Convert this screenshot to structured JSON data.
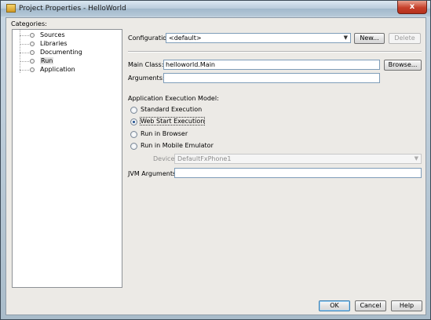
{
  "window": {
    "title": "Project Properties - HelloWorld",
    "close_glyph": "x",
    "accent_color": "#c6402b"
  },
  "categories": {
    "label": "Categories:",
    "items": [
      {
        "label": "Sources",
        "selected": false
      },
      {
        "label": "Libraries",
        "selected": false
      },
      {
        "label": "Documenting",
        "selected": false
      },
      {
        "label": "Run",
        "selected": true
      },
      {
        "label": "Application",
        "selected": false
      }
    ]
  },
  "configuration": {
    "label": "Configuration:",
    "value": "<default>",
    "new_button": "New...",
    "delete_button": "Delete"
  },
  "main_class": {
    "label": "Main Class:",
    "value": "helloworld.Main",
    "browse_button": "Browse..."
  },
  "arguments": {
    "label": "Arguments:",
    "value": ""
  },
  "execution_model": {
    "heading": "Application Execution Model:",
    "options": [
      {
        "label": "Standard Execution",
        "selected": false
      },
      {
        "label": "Web Start Execution",
        "selected": true
      },
      {
        "label": "Run in Browser",
        "selected": false
      },
      {
        "label": "Run in Mobile Emulator",
        "selected": false
      }
    ]
  },
  "device": {
    "label": "Device:",
    "value": "DefaultFxPhone1"
  },
  "jvm_arguments": {
    "label": "JVM Arguments:",
    "value": ""
  },
  "footer": {
    "ok_button": "OK",
    "cancel_button": "Cancel",
    "help_button": "Help"
  }
}
